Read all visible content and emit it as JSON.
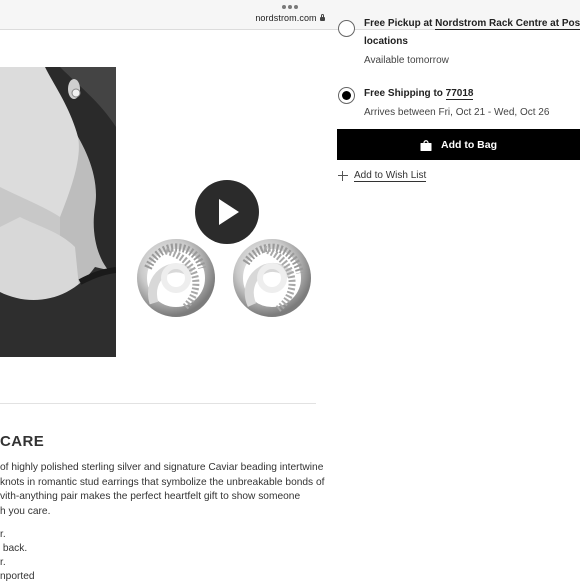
{
  "browser": {
    "url": "nordstrom.com"
  },
  "delivery": {
    "pickup": {
      "prefix": "Free Pickup at",
      "store_link": "Nordstrom Rack Centre at Post O",
      "location_word": "locations",
      "availability": "Available tomorrow",
      "selected": false
    },
    "shipping": {
      "prefix": "Free Shipping to",
      "zip": "77018",
      "arrival": "Arrives between Fri, Oct 21 - Wed, Oct 26",
      "selected": true
    }
  },
  "actions": {
    "add_to_bag": "Add to Bag",
    "add_to_wish_list": "Add to Wish List"
  },
  "details": {
    "section_title": "CARE",
    "description_lines": [
      "of highly polished sterling silver and signature Caviar beading intertwine",
      "knots in romantic stud earrings that symbolize the unbreakable bonds of",
      "vith-anything pair makes the perfect heartfelt gift to show someone",
      "h you care."
    ],
    "bullet_lines": [
      "r.",
      " back.",
      "r.",
      "nported"
    ]
  },
  "icons": {
    "video": "play-icon",
    "bag": "shopping-bag-icon",
    "wishlist": "plus-icon",
    "secure": "lock-icon"
  }
}
